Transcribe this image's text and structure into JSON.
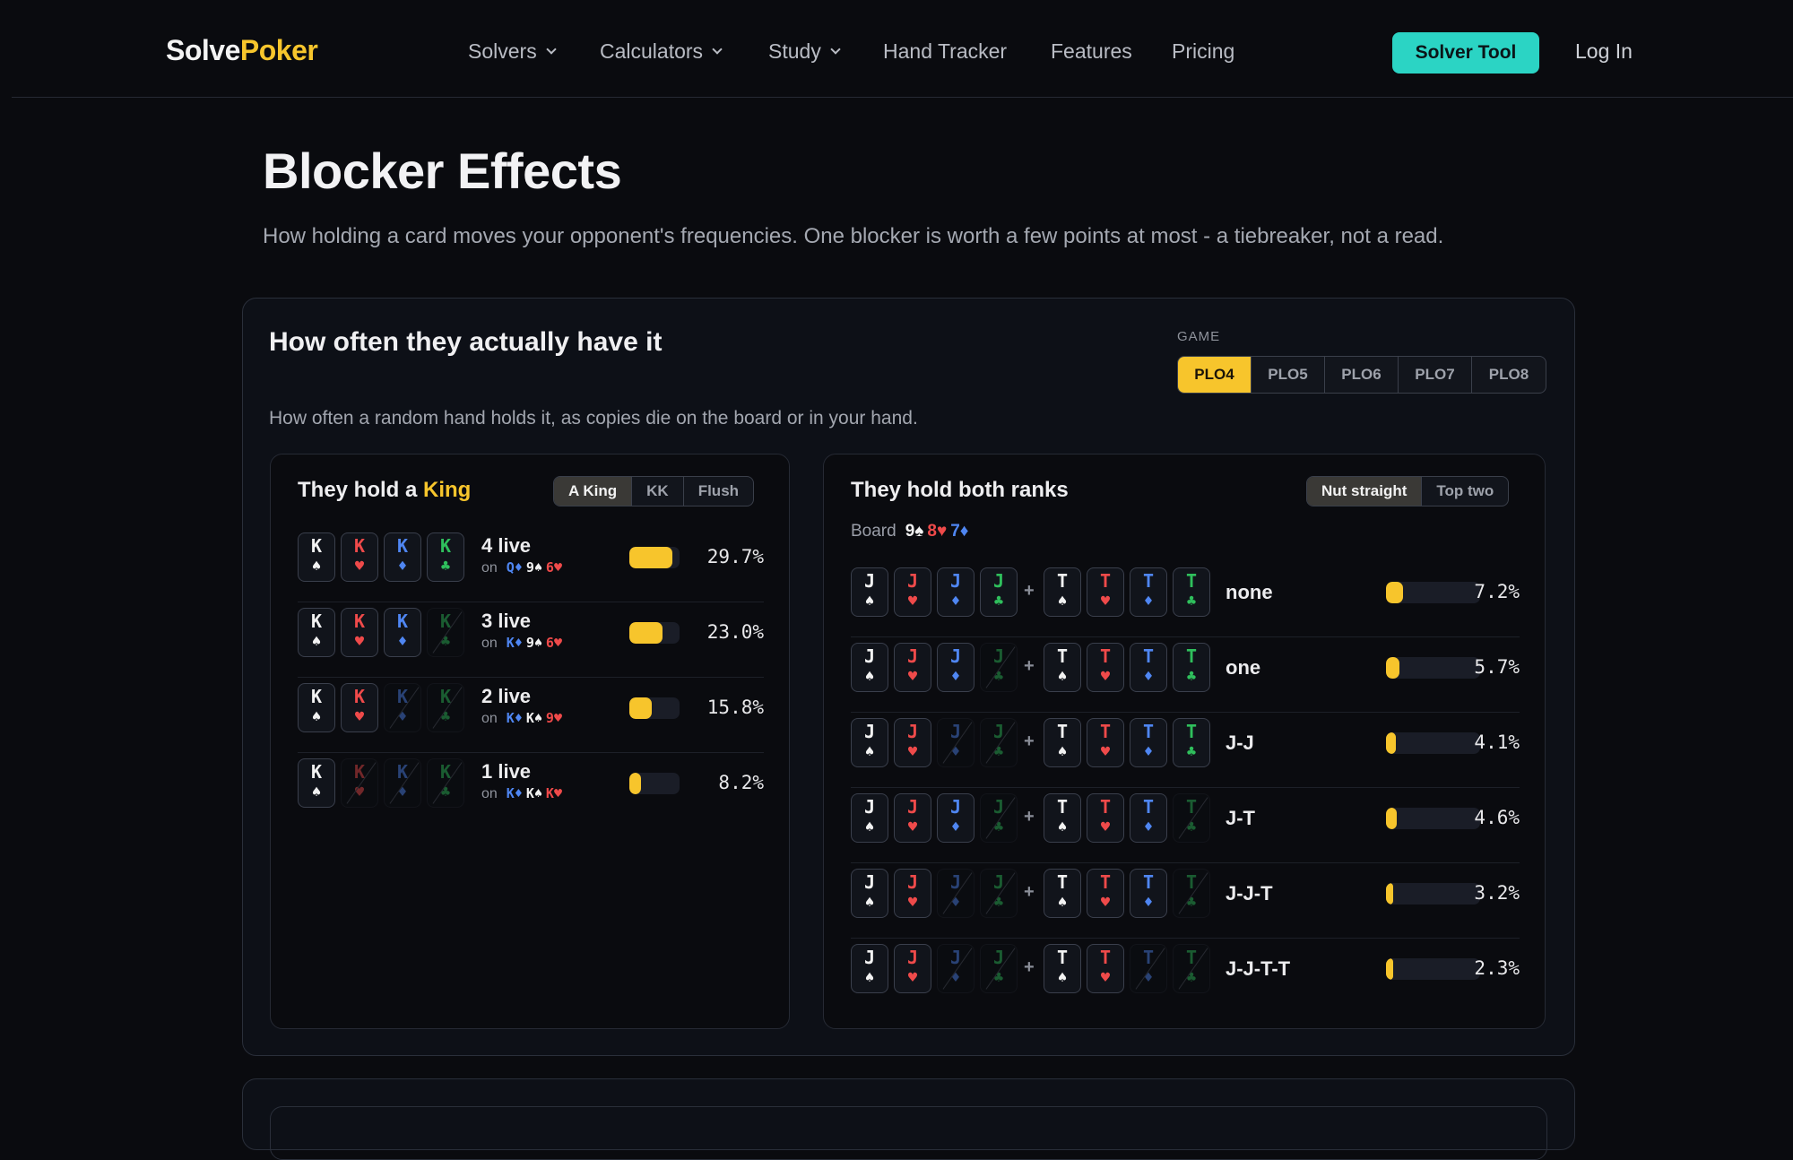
{
  "nav": {
    "logo_a": "Solve",
    "logo_b": "Poker",
    "items": [
      {
        "label": "Solvers",
        "dropdown": true
      },
      {
        "label": "Calculators",
        "dropdown": true
      },
      {
        "label": "Study",
        "dropdown": true
      },
      {
        "label": "Hand Tracker",
        "dropdown": false
      },
      {
        "label": "Features",
        "dropdown": false
      },
      {
        "label": "Pricing",
        "dropdown": false
      }
    ],
    "cta": "Solver Tool",
    "login": "Log In"
  },
  "page": {
    "title": "Blocker Effects",
    "subtitle": "How holding a card moves your opponent's frequencies. One blocker is worth a few points at most - a tiebreaker, not a read."
  },
  "panel": {
    "title": "How often they actually have it",
    "description": "How often a random hand holds it, as copies die on the board or in your hand.",
    "game_label": "GAME",
    "games": [
      "PLO4",
      "PLO5",
      "PLO6",
      "PLO7",
      "PLO8"
    ],
    "selected_game": "PLO4"
  },
  "left": {
    "title_prefix": "They hold a ",
    "title_highlight": "King",
    "tabs": [
      "A King",
      "KK",
      "Flush"
    ],
    "selected_tab": "A King",
    "on_word": "on",
    "rows": [
      {
        "label": "4 live",
        "cards": [
          [
            "K",
            "s",
            true
          ],
          [
            "K",
            "h",
            true
          ],
          [
            "K",
            "d",
            true
          ],
          [
            "K",
            "c",
            true
          ]
        ],
        "on": [
          [
            "Q♦",
            "d"
          ],
          [
            "9♠",
            "s"
          ],
          [
            "6♥",
            "h"
          ]
        ],
        "pct": "29.7%",
        "value": 29.7
      },
      {
        "label": "3 live",
        "cards": [
          [
            "K",
            "s",
            true
          ],
          [
            "K",
            "h",
            true
          ],
          [
            "K",
            "d",
            true
          ],
          [
            "K",
            "c",
            false
          ]
        ],
        "on": [
          [
            "K♦",
            "d"
          ],
          [
            "9♠",
            "s"
          ],
          [
            "6♥",
            "h"
          ]
        ],
        "pct": "23.0%",
        "value": 23.0
      },
      {
        "label": "2 live",
        "cards": [
          [
            "K",
            "s",
            true
          ],
          [
            "K",
            "h",
            true
          ],
          [
            "K",
            "d",
            false
          ],
          [
            "K",
            "c",
            false
          ]
        ],
        "on": [
          [
            "K♦",
            "d"
          ],
          [
            "K♠",
            "s"
          ],
          [
            "9♥",
            "h"
          ]
        ],
        "pct": "15.8%",
        "value": 15.8
      },
      {
        "label": "1 live",
        "cards": [
          [
            "K",
            "s",
            true
          ],
          [
            "K",
            "h",
            false
          ],
          [
            "K",
            "d",
            false
          ],
          [
            "K",
            "c",
            false
          ]
        ],
        "on": [
          [
            "K♦",
            "d"
          ],
          [
            "K♠",
            "s"
          ],
          [
            "K♥",
            "h"
          ]
        ],
        "pct": "8.2%",
        "value": 8.2
      }
    ]
  },
  "right": {
    "title": "They hold both ranks",
    "tabs": [
      "Nut straight",
      "Top two"
    ],
    "selected_tab": "Nut straight",
    "board_label": "Board",
    "board": [
      [
        "9♠",
        "s"
      ],
      [
        "8♥",
        "h"
      ],
      [
        "7♦",
        "d"
      ]
    ],
    "rows": [
      {
        "label": "none",
        "j": [
          1,
          1,
          1,
          1
        ],
        "t": [
          1,
          1,
          1,
          1
        ],
        "pct": "7.2%",
        "value": 7.2
      },
      {
        "label": "one",
        "j": [
          1,
          1,
          1,
          0
        ],
        "t": [
          1,
          1,
          1,
          1
        ],
        "pct": "5.7%",
        "value": 5.7
      },
      {
        "label": "J-J",
        "j": [
          1,
          1,
          0,
          0
        ],
        "t": [
          1,
          1,
          1,
          1
        ],
        "pct": "4.1%",
        "value": 4.1
      },
      {
        "label": "J-T",
        "j": [
          1,
          1,
          1,
          0
        ],
        "t": [
          1,
          1,
          1,
          0
        ],
        "pct": "4.6%",
        "value": 4.6
      },
      {
        "label": "J-J-T",
        "j": [
          1,
          1,
          0,
          0
        ],
        "t": [
          1,
          1,
          1,
          0
        ],
        "pct": "3.2%",
        "value": 3.2
      },
      {
        "label": "J-J-T-T",
        "j": [
          1,
          1,
          0,
          0
        ],
        "t": [
          1,
          1,
          0,
          0
        ],
        "pct": "2.3%",
        "value": 2.3
      }
    ]
  },
  "suits": {
    "s": "♠",
    "h": "♥",
    "d": "♦",
    "c": "♣"
  },
  "colors": {
    "accent": "#f7c52c",
    "cta": "#2bd4c4",
    "spade": "#f2f2f2",
    "heart": "#ef4a4a",
    "diamond": "#4f86f2",
    "club": "#2fbf5c"
  }
}
